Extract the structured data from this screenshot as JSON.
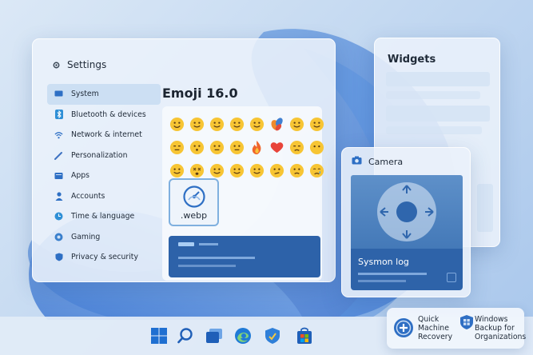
{
  "settings": {
    "title": "Settings",
    "nav": [
      {
        "label": "System",
        "icon": "monitor-icon",
        "active": true
      },
      {
        "label": "Bluetooth & devices",
        "icon": "bluetooth-icon"
      },
      {
        "label": "Network & internet",
        "icon": "wifi-icon"
      },
      {
        "label": "Personalization",
        "icon": "brush-icon"
      },
      {
        "label": "Apps",
        "icon": "apps-icon"
      },
      {
        "label": "Accounts",
        "icon": "person-icon"
      },
      {
        "label": "Time & language",
        "icon": "clock-icon"
      },
      {
        "label": "Gaming",
        "icon": "gamepad-icon"
      },
      {
        "label": "Privacy & security",
        "icon": "shield-icon"
      }
    ],
    "content_title": "Emoji 16.0",
    "emoji_rows": [
      [
        "😀",
        "😊",
        "😊",
        "😊",
        "😊",
        "🍂",
        "😊",
        "😊"
      ],
      [
        "😑",
        "😗",
        "😐",
        "😐",
        "🔥",
        "❤️",
        "😒",
        "😶"
      ],
      [
        "😊",
        "😵",
        "😊",
        "😊",
        "😊",
        "😕",
        "😕",
        "😢"
      ]
    ],
    "webp_label": ".webp"
  },
  "widgets": {
    "title": "Widgets"
  },
  "camera": {
    "title": "Camera",
    "log_label": "Sysmon log"
  },
  "recovery": {
    "quick_machine_recovery": "Quick\nMachine\nRecovery",
    "windows_backup": "Windows\nBackup for\nOrganizations"
  },
  "taskbar": {
    "icons": [
      "windows-start-icon",
      "search-icon",
      "task-view-icon",
      "edge-browser-icon",
      "security-shield-icon",
      "store-icon"
    ]
  },
  "colors": {
    "accent": "#2e63a9",
    "active_nav": "#cadcf2",
    "taskbar": "#e2ecf8"
  }
}
